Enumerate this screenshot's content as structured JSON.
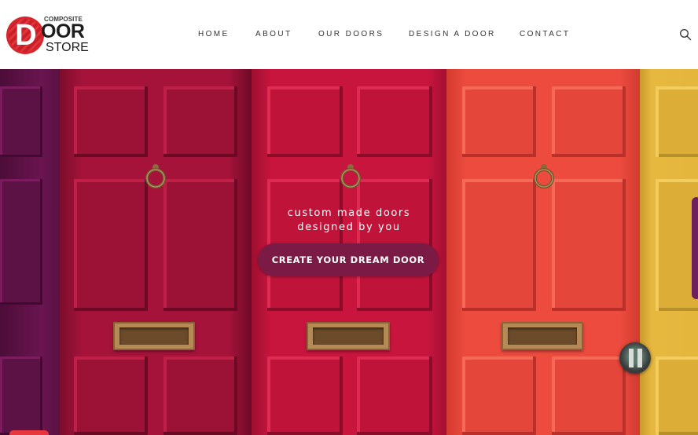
{
  "logo": {
    "top_text": "COMPOSITE",
    "letter_d": "D",
    "main_text": "OOR",
    "bottom_text": "STORE"
  },
  "nav": {
    "items": [
      {
        "label": "HOME"
      },
      {
        "label": "ABOUT"
      },
      {
        "label": "OUR DOORS"
      },
      {
        "label": "DESIGN A DOOR"
      },
      {
        "label": "CONTACT"
      }
    ],
    "search_icon": "search-icon"
  },
  "hero": {
    "tagline_line1": "custom made doors",
    "tagline_line2": "designed by you",
    "cta_label": "CREATE YOUR DREAM DOOR",
    "door_colors": [
      "#5e1246",
      "#a4123a",
      "#c8133c",
      "#ea4a3d",
      "#e4b63c"
    ]
  },
  "colors": {
    "cta_background": "#7a1a45",
    "logo_red": "#d8262f",
    "nav_text": "#333333"
  }
}
